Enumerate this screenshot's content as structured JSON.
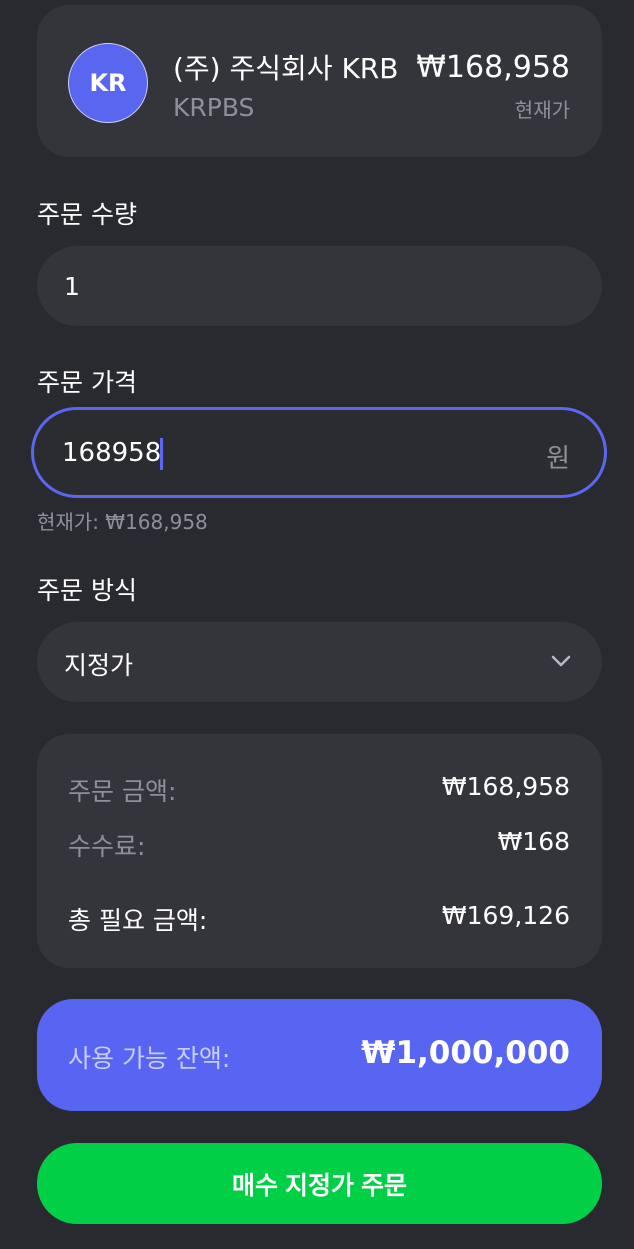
{
  "stock": {
    "avatar_text": "KR",
    "name": "(주) 주식회사 KRB",
    "code": "KRPBS",
    "price": "₩168,958",
    "price_label": "현재가"
  },
  "quantity": {
    "label": "주문 수량",
    "value": "1"
  },
  "price_input": {
    "label": "주문 가격",
    "value": "168958",
    "unit": "원",
    "hint": "현재가: ₩168,958"
  },
  "order_type": {
    "label": "주문 방식",
    "selected": "지정가"
  },
  "summary": {
    "order_amount_label": "주문 금액:",
    "order_amount": "₩168,958",
    "fee_label": "수수료:",
    "fee": "₩168",
    "total_label": "총 필요 금액:",
    "total": "₩169,126"
  },
  "balance": {
    "label": "사용 가능 잔액:",
    "value": "₩1,000,000"
  },
  "submit_label": "매수 지정가 주문",
  "colors": {
    "accent": "#5865f2",
    "buy": "#01cf46",
    "background": "#292a2f",
    "card": "#34353b"
  }
}
